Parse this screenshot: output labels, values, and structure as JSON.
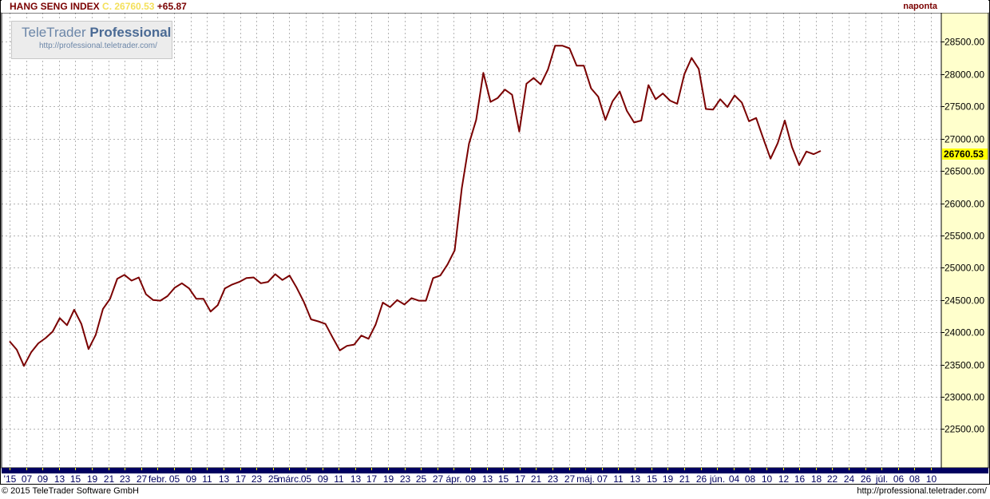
{
  "header": {
    "name": "HANG SENG INDEX",
    "close_label": "C. 26760.53",
    "change": "+65.87",
    "frequency": "naponta"
  },
  "watermark": {
    "brand_a": "TeleTrader",
    "brand_b": "Professional",
    "url": "http://professional.teletrader.com/"
  },
  "footer": {
    "copyright": "© 2015 TeleTrader Software GmbH",
    "url": "http://professional.teletrader.com/"
  },
  "colors": {
    "line": "#7a0000",
    "axis_panel": "#ffffcc",
    "date_bar": "#000060",
    "date_text": "#ffff00",
    "grid": "#b4b4b4",
    "price_tag": "#ffff00"
  },
  "chart_data": {
    "type": "line",
    "title": "HANG SENG INDEX",
    "last_value_label": "26760.53",
    "ylim": [
      21900,
      28950
    ],
    "yticks": [
      22500,
      23000,
      23500,
      24000,
      24500,
      25000,
      25500,
      26000,
      26500,
      27000,
      27500,
      28000,
      28500
    ],
    "ytick_labels": [
      "22500.00",
      "23000.00",
      "23500.00",
      "24000.00",
      "24500.00",
      "25000.00",
      "25500.00",
      "26000.00",
      "26500.00",
      "27000.00",
      "27500.00",
      "28000.00",
      "28500.00"
    ],
    "xtick_labels": [
      "'15",
      "07",
      "09",
      "13",
      "15",
      "19",
      "21",
      "23",
      "27",
      "febr.",
      "05",
      "09",
      "11",
      "13",
      "17",
      "23",
      "25",
      "márc.",
      "05",
      "09",
      "11",
      "13",
      "17",
      "19",
      "23",
      "25",
      "27",
      "ápr.",
      "09",
      "13",
      "15",
      "17",
      "21",
      "23",
      "27",
      "máj.",
      "07",
      "11",
      "13",
      "15",
      "19",
      "21",
      "26",
      "jún.",
      "04",
      "08",
      "10",
      "12",
      "16",
      "18",
      "22",
      "24",
      "26",
      "júl.",
      "06",
      "08",
      "10"
    ],
    "grid": true,
    "series": [
      {
        "values": [
          23860,
          23730,
          23480,
          23690,
          23830,
          23910,
          24010,
          24220,
          24110,
          24350,
          24130,
          23740,
          23960,
          24360,
          24520,
          24830,
          24890,
          24800,
          24850,
          24590,
          24500,
          24490,
          24560,
          24690,
          24760,
          24680,
          24520,
          24520,
          24320,
          24420,
          24680,
          24740,
          24780,
          24840,
          24850,
          24760,
          24780,
          24900,
          24810,
          24880,
          24690,
          24470,
          24200,
          24170,
          24130,
          23920,
          23720,
          23790,
          23810,
          23950,
          23900,
          24120,
          24460,
          24390,
          24500,
          24430,
          24530,
          24490,
          24490,
          24840,
          24880,
          25050,
          25270,
          26230,
          26920,
          27290,
          28020,
          27570,
          27630,
          27760,
          27680,
          27110,
          27850,
          27940,
          27840,
          28070,
          28440,
          28440,
          28400,
          28130,
          28130,
          27780,
          27650,
          27290,
          27580,
          27730,
          27430,
          27250,
          27280,
          27830,
          27610,
          27700,
          27590,
          27540,
          28000,
          28250,
          28080,
          27460,
          27450,
          27610,
          27490,
          27670,
          27560,
          27270,
          27320,
          27000,
          26690,
          26930,
          27280,
          26870,
          26590,
          26800,
          26760,
          26810
        ]
      }
    ]
  }
}
